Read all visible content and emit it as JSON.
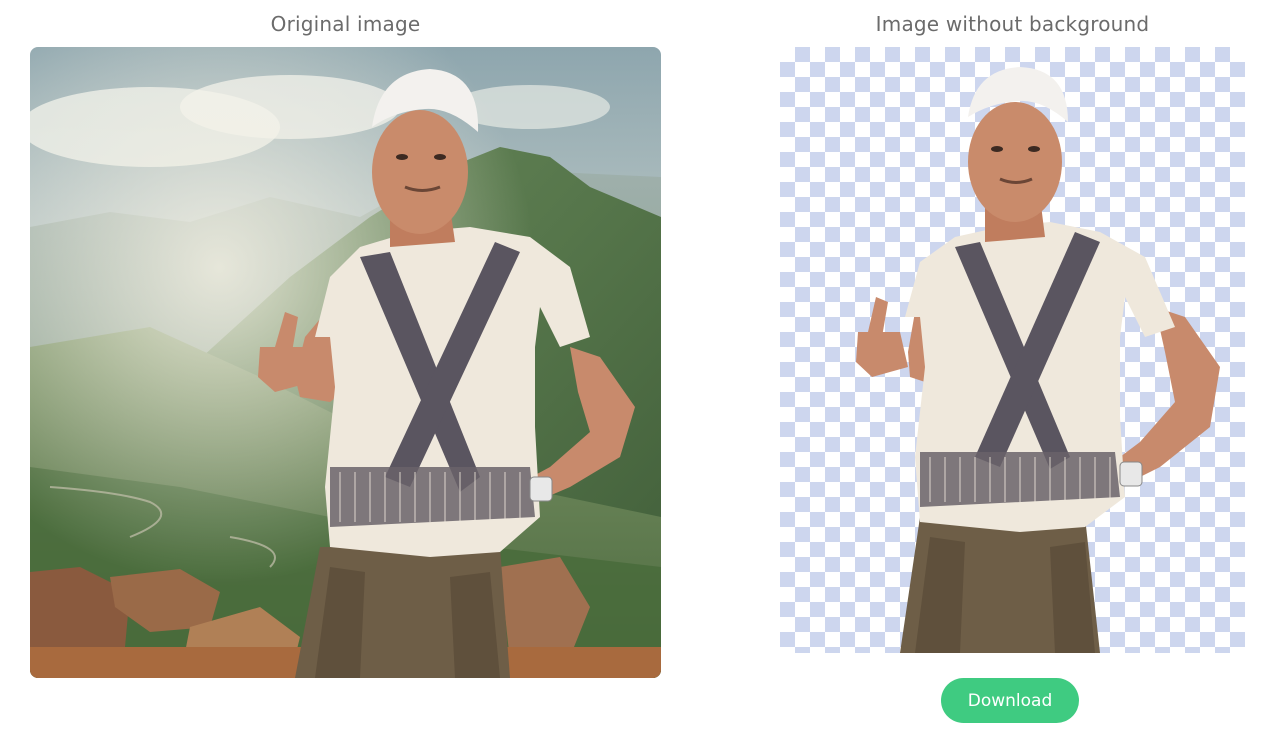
{
  "left_panel": {
    "title": "Original image"
  },
  "right_panel": {
    "title": "Image without background",
    "download_label": "Download"
  },
  "colors": {
    "checker_blue": "#cdd6ee",
    "download_button": "#3fcb81",
    "title_text": "#6b6b6b"
  }
}
